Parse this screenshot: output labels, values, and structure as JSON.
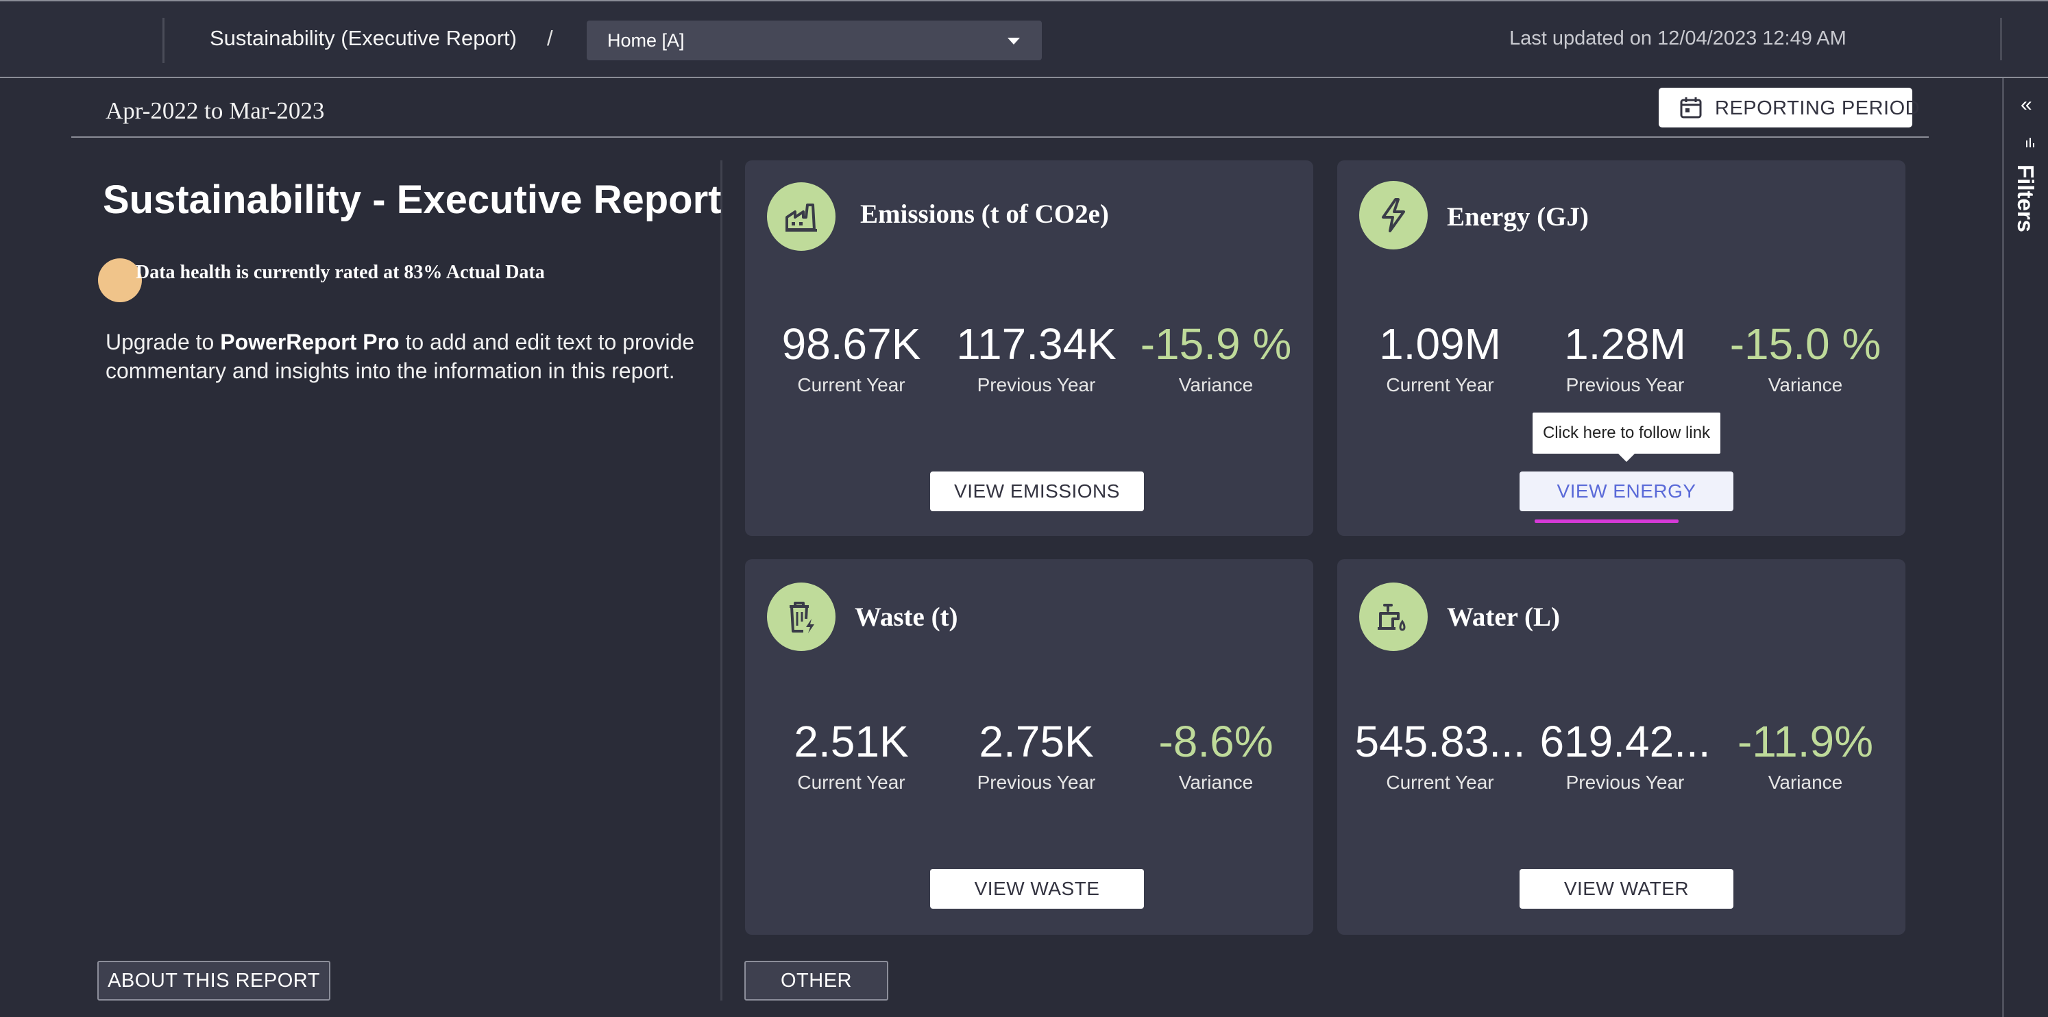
{
  "header": {
    "breadcrumb_title": "Sustainability (Executive Report)",
    "separator": "/",
    "page_select": {
      "value": "Home [A]"
    },
    "last_updated": "Last updated on 12/04/2023 12:49 AM"
  },
  "filters_pane": {
    "label": "Filters",
    "collapse_icon": "double-chevron-left-icon"
  },
  "period": {
    "range": "Apr-2022 to Mar-2023",
    "button_label": "REPORTING PERIOD",
    "button_icon": "calendar-icon"
  },
  "left_panel": {
    "title": "Sustainability - Executive Report",
    "health_text": "Data health is currently rated at 83% Actual Data",
    "health_color": "#f0c48a",
    "upgrade_prefix": "Upgrade to ",
    "upgrade_product": "PowerReport Pro",
    "upgrade_suffix": " to add and edit text to provide commentary and insights into the information in this report.",
    "about_button": "ABOUT THIS REPORT"
  },
  "accent_color": "#bfdb9a",
  "cards": [
    {
      "title": "Emissions (t of CO2e)",
      "icon": "factory-icon",
      "current": "98.67K",
      "previous": "117.34K",
      "variance": "-15.9 %",
      "current_label": "Current Year",
      "previous_label": "Previous Year",
      "variance_label": "Variance",
      "button": "VIEW EMISSIONS"
    },
    {
      "title": "Energy (GJ)",
      "icon": "lightning-bolt-icon",
      "current": "1.09M",
      "previous": "1.28M",
      "variance": "-15.0 %",
      "current_label": "Current Year",
      "previous_label": "Previous Year",
      "variance_label": "Variance",
      "button": "VIEW ENERGY",
      "tooltip": "Click here to follow link"
    },
    {
      "title": "Waste (t)",
      "icon": "trash-bin-icon",
      "current": "2.51K",
      "previous": "2.75K",
      "variance": "-8.6%",
      "current_label": "Current Year",
      "previous_label": "Previous Year",
      "variance_label": "Variance",
      "button": "VIEW WASTE"
    },
    {
      "title": "Water (L)",
      "icon": "water-tap-icon",
      "current": "545.83...",
      "previous": "619.42...",
      "variance": "-11.9%",
      "current_label": "Current Year",
      "previous_label": "Previous Year",
      "variance_label": "Variance",
      "button": "VIEW WATER"
    }
  ],
  "other_button": "OTHER"
}
